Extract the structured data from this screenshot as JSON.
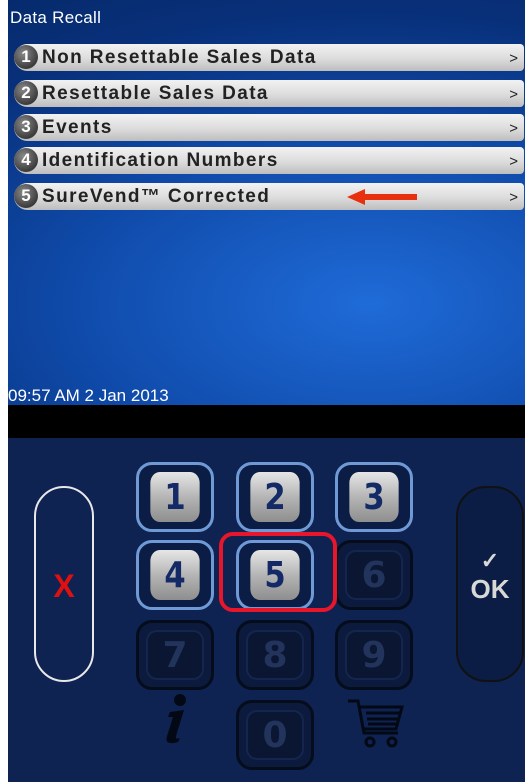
{
  "screen": {
    "title": "Data Recall",
    "datetime": "09:57 AM 2 Jan 2013"
  },
  "menu": [
    {
      "num": "1",
      "label": "Non Resettable Sales Data",
      "chevron": ">"
    },
    {
      "num": "2",
      "label": "Resettable Sales Data",
      "chevron": ">"
    },
    {
      "num": "3",
      "label": "Events",
      "chevron": ">"
    },
    {
      "num": "4",
      "label": "Identification Numbers",
      "chevron": ">"
    },
    {
      "num": "5",
      "label": "SureVend™ Corrected",
      "chevron": ">"
    }
  ],
  "keypad": {
    "cancel_label": "X",
    "ok_label": "OK",
    "keys": [
      "1",
      "2",
      "3",
      "4",
      "5",
      "6",
      "7",
      "8",
      "9",
      "0"
    ],
    "active_keys": [
      "1",
      "2",
      "3",
      "4",
      "5"
    ],
    "highlighted_key": "5",
    "info_icon": "info-icon",
    "cart_icon": "cart-icon"
  },
  "colors": {
    "screen_blue": "#0f4aa9",
    "pad_navy": "#0e2352",
    "cancel_red": "#e01010",
    "highlight_red": "#e8162a",
    "arrow_red": "#e8300e"
  }
}
